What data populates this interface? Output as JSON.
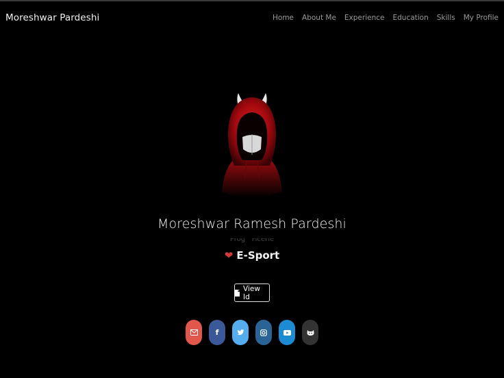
{
  "navbar": {
    "brand": "Moreshwar Pardeshi",
    "links": [
      "Home",
      "About Me",
      "Experience",
      "Education",
      "Skills",
      "My Profile"
    ]
  },
  "profile": {
    "name": "Moreshwar Ramesh Pardeshi",
    "faded_text": "Prog   Ficerle",
    "interest_icon": "heart-icon",
    "interest": "E-Sport"
  },
  "actions": {
    "view_id_icon": "document-icon",
    "view_id_label": "View Id"
  },
  "social": [
    {
      "name": "email-icon",
      "color": "#e2574c"
    },
    {
      "name": "facebook-icon",
      "color": "#3b5998"
    },
    {
      "name": "twitter-icon",
      "color": "#55acee"
    },
    {
      "name": "instagram-icon",
      "color": "#2a6496"
    },
    {
      "name": "youtube-icon",
      "color": "#1d8bd1"
    },
    {
      "name": "github-icon",
      "color": "#333333"
    }
  ],
  "colors": {
    "background": "#000000",
    "hood": "#c0171b",
    "accent_heart": "#d23a3a"
  }
}
